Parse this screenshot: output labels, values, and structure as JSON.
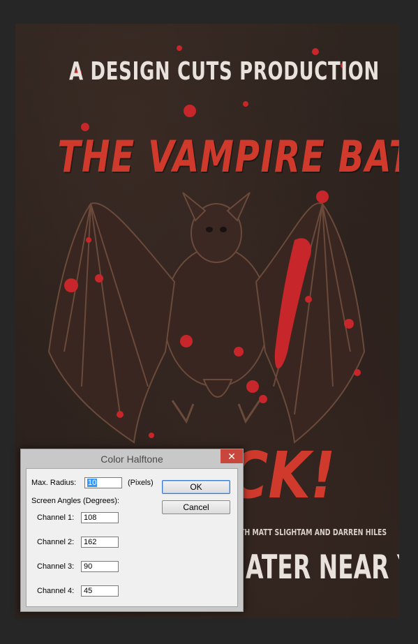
{
  "poster": {
    "top_line": "A DESIGN CUTS PRODUCTION",
    "title": "THE VAMPIRE BATS",
    "big_word_partial": "CK!",
    "credits_partial": "TH MATT SLIGHTAM AND DARREN HILES",
    "theater_partial": "ATER NEAR YOU",
    "colors": {
      "background": "#2c221d",
      "title_red": "#cf3a2c",
      "blood_red": "#c7262a",
      "cream_text": "#e8e1dc",
      "bat_fill": "#3a2620"
    }
  },
  "dialog": {
    "title": "Color Halftone",
    "close_icon": "close-icon",
    "max_radius_label": "Max. Radius:",
    "max_radius_value": "10",
    "max_radius_unit": "(Pixels)",
    "screen_angles_label": "Screen Angles (Degrees):",
    "channels": [
      {
        "label": "Channel 1:",
        "value": "108"
      },
      {
        "label": "Channel 2:",
        "value": "162"
      },
      {
        "label": "Channel 3:",
        "value": "90"
      },
      {
        "label": "Channel 4:",
        "value": "45"
      }
    ],
    "ok_label": "OK",
    "cancel_label": "Cancel"
  }
}
